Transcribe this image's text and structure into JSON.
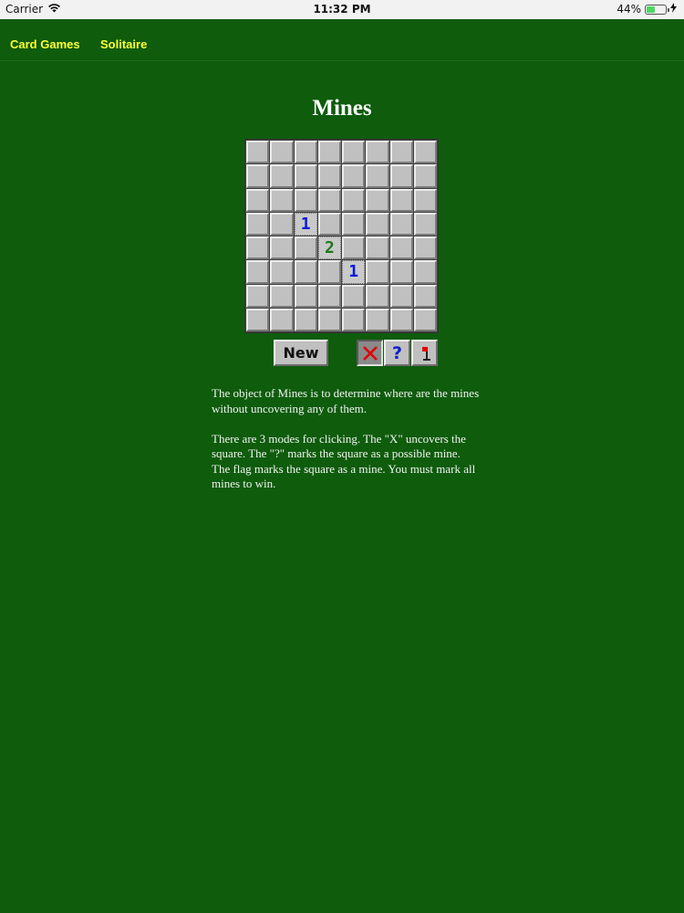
{
  "status_bar": {
    "carrier": "Carrier",
    "time": "11:32 PM",
    "battery": "44%",
    "battery_level": 0.44
  },
  "nav": {
    "links": [
      "Card Games",
      "Solitaire"
    ]
  },
  "game": {
    "title": "Mines",
    "rows": 8,
    "cols": 8,
    "revealed": [
      {
        "row": 3,
        "col": 2,
        "value": "1"
      },
      {
        "row": 4,
        "col": 3,
        "value": "2"
      },
      {
        "row": 5,
        "col": 4,
        "value": "1"
      }
    ],
    "new_button": "New",
    "modes": [
      {
        "name": "uncover",
        "icon": "x-icon",
        "active": true
      },
      {
        "name": "question",
        "icon": "question-icon",
        "symbol": "?",
        "active": false
      },
      {
        "name": "flag",
        "icon": "flag-icon",
        "active": false
      }
    ],
    "number_colors": {
      "1": "#0b18d8",
      "2": "#1a7a1a"
    }
  },
  "description": {
    "paragraphs": [
      "The object of Mines is to determine where are the mines without uncovering any of them.",
      "There are 3 modes for clicking. The \"X\" uncovers the square. The \"?\" marks the square as a possible mine. The flag marks the square as a mine. You must mark all mines to win."
    ]
  }
}
